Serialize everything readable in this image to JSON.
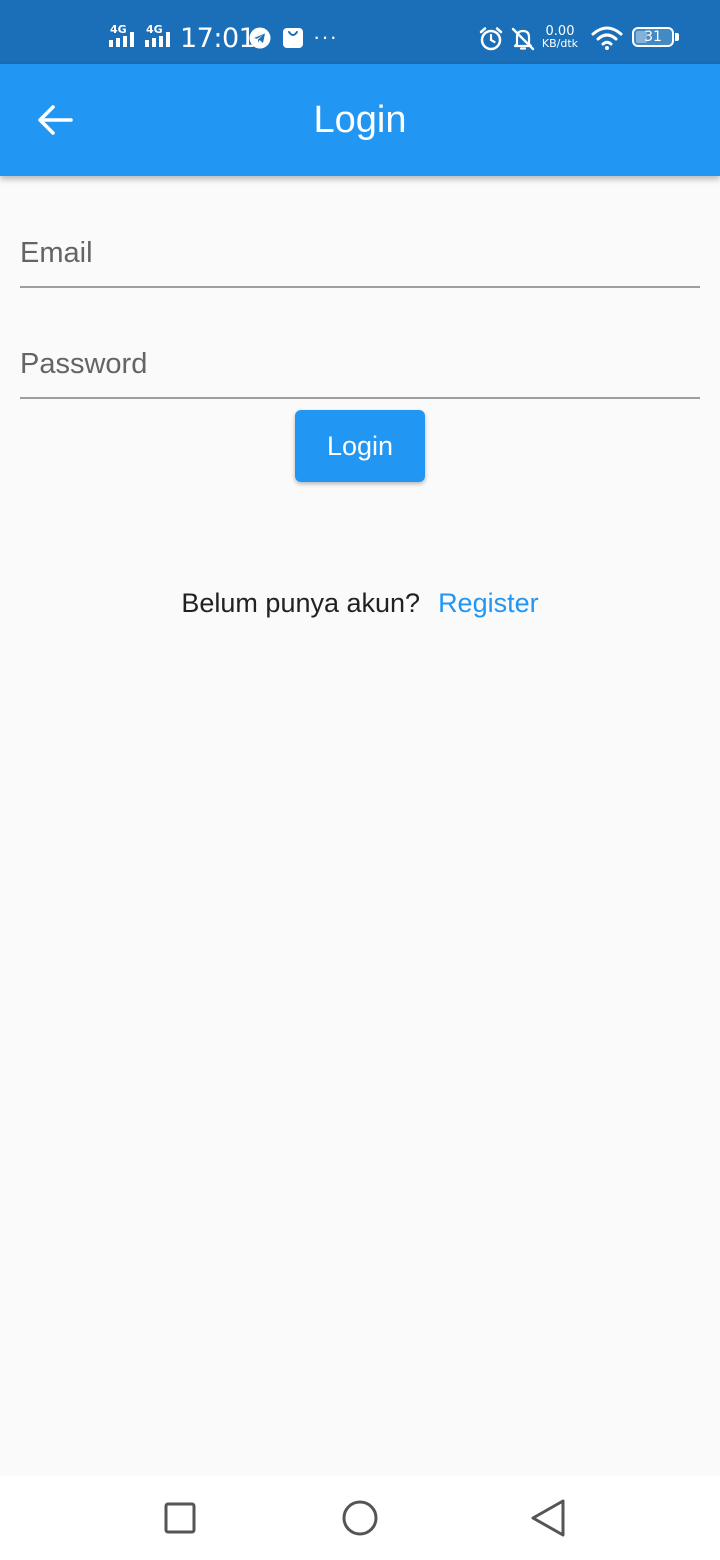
{
  "status_bar": {
    "signal_1_label": "4G",
    "signal_2_label": "4G",
    "time": "17:01",
    "net_speed_value": "0.00",
    "net_speed_unit": "KB/dtk",
    "battery_percent": "31",
    "battery_level": 0.31,
    "icons": [
      "signal-icon",
      "signal-icon",
      "telegram-icon",
      "shopping-bag-icon",
      "more-icon",
      "alarm-icon",
      "notifications-off-icon",
      "wifi-icon",
      "battery-icon"
    ]
  },
  "app_bar": {
    "title": "Login",
    "back_icon": "arrow-back-icon",
    "color": "#2196F3"
  },
  "form": {
    "email_placeholder": "Email",
    "email_value": "",
    "password_placeholder": "Password",
    "password_value": "",
    "login_button_label": "Login"
  },
  "register": {
    "prompt": "Belum punya akun?",
    "link_label": "Register",
    "link_color": "#2196F3"
  },
  "nav_bar": {
    "icons": [
      "recent-apps-icon",
      "home-icon",
      "back-icon"
    ]
  }
}
